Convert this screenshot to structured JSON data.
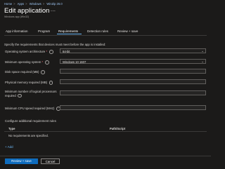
{
  "breadcrumb": [
    "Home",
    "Apps",
    "Windows",
    "WinZip 26.0"
  ],
  "header": {
    "title": "Edit application",
    "more": "...",
    "subtitle": "Windows app (Win32)"
  },
  "tabs": [
    {
      "label": "App information",
      "active": false
    },
    {
      "label": "Program",
      "active": false
    },
    {
      "label": "Requirements",
      "active": true
    },
    {
      "label": "Detection rules",
      "active": false
    },
    {
      "label": "Review + save",
      "active": false
    }
  ],
  "description": "Specify the requirements that devices must meet before the app is installed:",
  "fields": {
    "os_arch": {
      "label": "Operating system architecture",
      "required": "*",
      "value": "64-bit"
    },
    "min_os": {
      "label": "Minimum operating system",
      "required": "*",
      "value": "Windows 10 1607"
    },
    "disk_space": {
      "label": "Disk space required (MB)",
      "value": ""
    },
    "memory": {
      "label": "Physical memory required (MB)",
      "value": ""
    },
    "cpu_count": {
      "label": "Minimum number of logical processors required",
      "value": ""
    },
    "cpu_speed": {
      "label": "Minimum CPU speed required (MHz)",
      "value": ""
    }
  },
  "additional_rules": {
    "label": "Configure additional requirement rules",
    "columns": [
      "Type",
      "Path/Script"
    ],
    "empty_text": "No requirements are specified.",
    "add_label": "+ Add"
  },
  "footer": {
    "primary": "Review + save",
    "secondary": "Cancel"
  },
  "icons": {
    "info": "info-icon",
    "chevron": "chevron-down-icon"
  },
  "colors": {
    "accent": "#0f6cbd",
    "link": "#6cb8f6",
    "background": "#1b1a19"
  }
}
